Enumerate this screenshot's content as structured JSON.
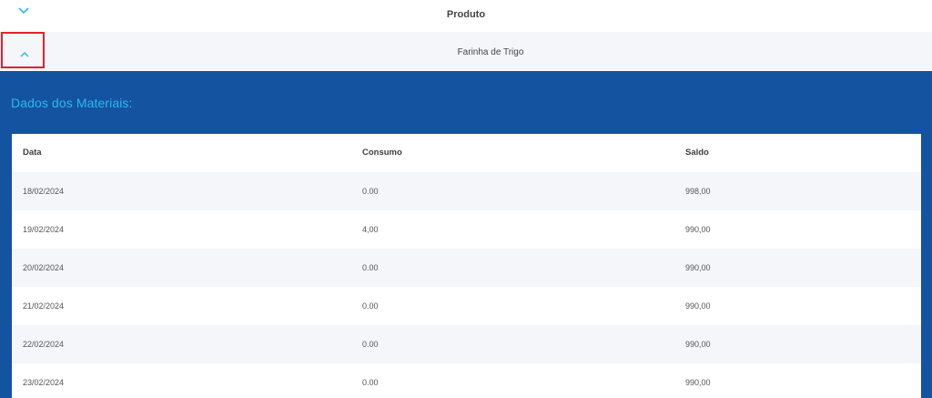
{
  "header": {
    "title": "Produto",
    "expand_icon": "chevron-down-icon"
  },
  "product_row": {
    "name": "Farinha de Trigo",
    "collapse_icon": "chevron-up-icon"
  },
  "panel": {
    "title": "Dados dos Materiais:",
    "background_color": "#14539f",
    "title_color": "#2fb7ee"
  },
  "table": {
    "columns": [
      "Data",
      "Consumo",
      "Saldo"
    ],
    "rows": [
      {
        "data": "18/02/2024",
        "consumo": "0.00",
        "saldo": "998,00"
      },
      {
        "data": "19/02/2024",
        "consumo": "4,00",
        "saldo": "990,00"
      },
      {
        "data": "20/02/2024",
        "consumo": "0.00",
        "saldo": "990,00"
      },
      {
        "data": "21/02/2024",
        "consumo": "0.00",
        "saldo": "990,00"
      },
      {
        "data": "22/02/2024",
        "consumo": "0.00",
        "saldo": "990,00"
      },
      {
        "data": "23/02/2024",
        "consumo": "0.00",
        "saldo": "990,00"
      }
    ]
  },
  "colors": {
    "accent": "#2fb7ee",
    "highlight_border": "#e3212c",
    "alt_row": "#f4f6fa"
  }
}
